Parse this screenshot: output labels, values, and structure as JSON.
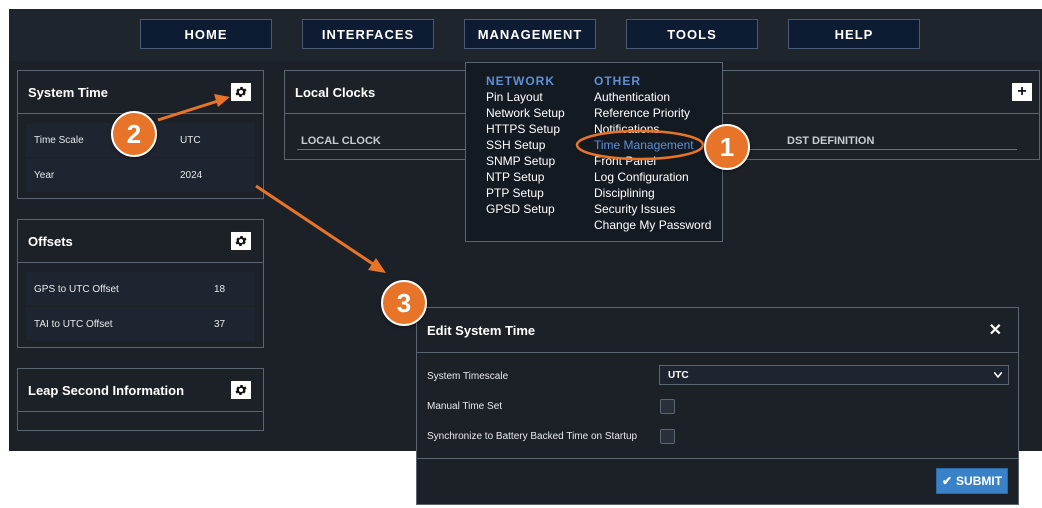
{
  "nav": {
    "home": "HOME",
    "interfaces": "INTERFACES",
    "management": "MANAGEMENT",
    "tools": "TOOLS",
    "help": "HELP"
  },
  "system_time": {
    "title": "System Time",
    "rows": [
      {
        "label": "Time Scale",
        "value": "UTC"
      },
      {
        "label": "Year",
        "value": "2024"
      }
    ]
  },
  "offsets": {
    "title": "Offsets",
    "rows": [
      {
        "label": "GPS to UTC Offset",
        "value": "18"
      },
      {
        "label": "TAI to UTC Offset",
        "value": "37"
      }
    ]
  },
  "leap": {
    "title": "Leap Second Information"
  },
  "local_clocks": {
    "title": "Local Clocks",
    "add_label": "+",
    "col1": "LOCAL CLOCK",
    "col2": "DST DEFINITION"
  },
  "management_menu": {
    "network_header": "NETWORK",
    "network_items": [
      "Pin Layout",
      "Network Setup",
      "HTTPS Setup",
      "SSH Setup",
      "SNMP Setup",
      "NTP Setup",
      "PTP Setup",
      "GPSD Setup"
    ],
    "other_header": "OTHER",
    "other_items": [
      "Authentication",
      "Reference Priority",
      "Notifications",
      "Time Management",
      "Front Panel",
      "Log Configuration",
      "Disciplining",
      "Security Issues",
      "Change My Password"
    ],
    "highlight_color": "#5f8fd8"
  },
  "callouts": {
    "one": "1",
    "two": "2",
    "three": "3",
    "color": "#e8742a"
  },
  "dialog": {
    "title": "Edit System Time",
    "close_label": "✕",
    "timescale_label": "System Timescale",
    "timescale_value": "UTC",
    "manual_label": "Manual Time Set",
    "sync_label": "Synchronize to Battery Backed Time on Startup",
    "submit_label": "SUBMIT",
    "submit_color": "#3a82c8"
  }
}
